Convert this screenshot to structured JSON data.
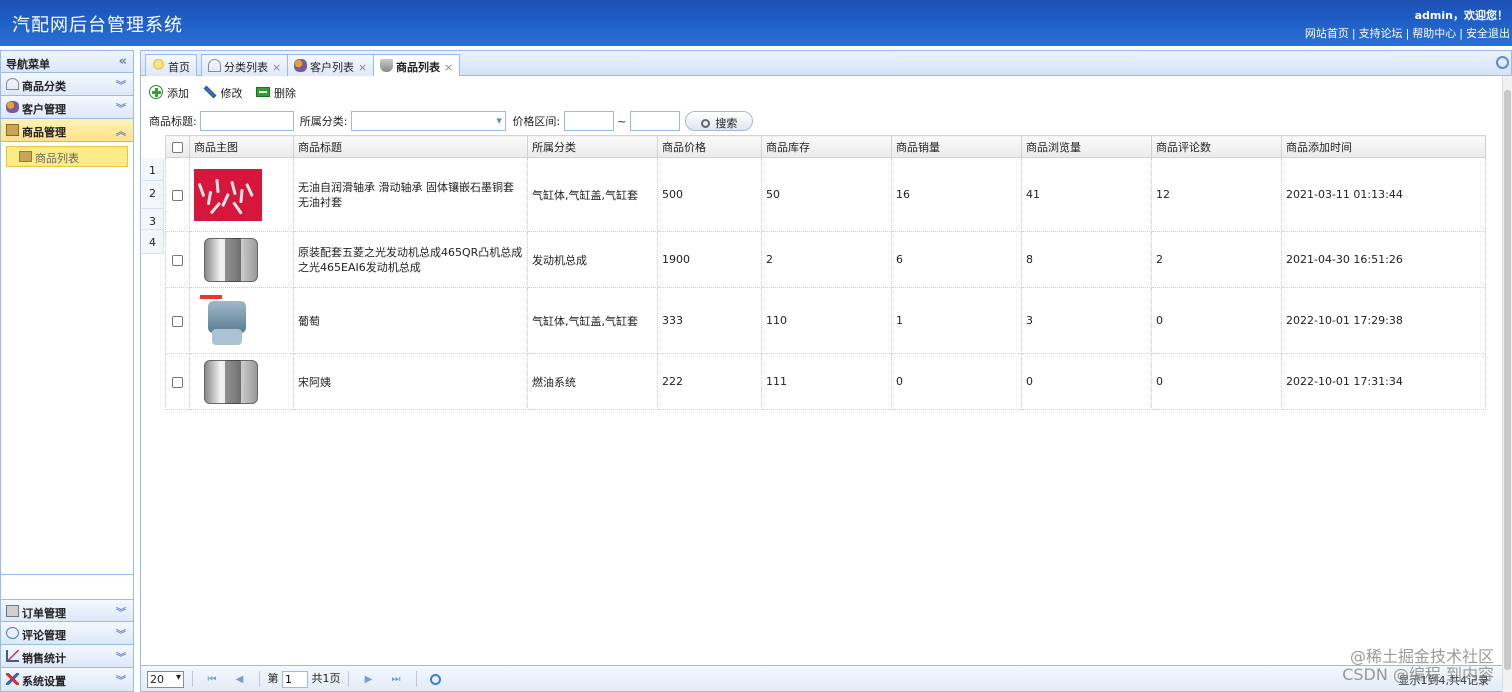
{
  "header": {
    "title": "汽配网后台管理系统",
    "welcome": "admin，欢迎您！",
    "links": [
      "网站首页",
      "支持论坛",
      "帮助中心",
      "安全退出"
    ]
  },
  "nav": {
    "title": "导航菜单",
    "sections_top": [
      {
        "label": "商品分类",
        "icon": "category-icon"
      },
      {
        "label": "客户管理",
        "icon": "users-icon"
      },
      {
        "label": "商品管理",
        "icon": "goods-icon",
        "active": true
      }
    ],
    "active_sub": "商品列表",
    "sections_bottom": [
      {
        "label": "订单管理",
        "icon": "order-icon"
      },
      {
        "label": "评论管理",
        "icon": "comment-icon"
      },
      {
        "label": "销售统计",
        "icon": "chart-icon"
      },
      {
        "label": "系统设置",
        "icon": "settings-icon"
      }
    ]
  },
  "tabs": [
    {
      "label": "首页",
      "icon": "bulb-icon",
      "closable": false
    },
    {
      "label": "分类列表",
      "icon": "category-icon",
      "closable": true
    },
    {
      "label": "客户列表",
      "icon": "users-icon",
      "closable": true
    },
    {
      "label": "商品列表",
      "icon": "cart-icon",
      "closable": true,
      "active": true
    }
  ],
  "toolbar": {
    "add": "添加",
    "edit": "修改",
    "delete": "删除"
  },
  "search": {
    "title_label": "商品标题:",
    "category_label": "所属分类:",
    "price_label": "价格区间:",
    "range_sep": "~",
    "button": "搜索"
  },
  "table": {
    "headers": [
      "商品主图",
      "商品标题",
      "所属分类",
      "商品价格",
      "商品库存",
      "商品销量",
      "商品浏览量",
      "商品评论数",
      "商品添加时间"
    ],
    "rows": [
      {
        "img": "pins",
        "title": "无油自润滑轴承 滑动轴承 固体镶嵌石墨铜套 无油衬套",
        "category": "气缸体,气缸盖,气缸套",
        "price": "500",
        "stock": "50",
        "sales": "16",
        "views": "41",
        "comments": "12",
        "time": "2021-03-11 01:13:44"
      },
      {
        "img": "filter",
        "title": "原装配套五菱之光发动机总成465QR凸机总成之光465EAI6发动机总成",
        "category": "发动机总成",
        "price": "1900",
        "stock": "2",
        "sales": "6",
        "views": "8",
        "comments": "2",
        "time": "2021-04-30 16:51:26"
      },
      {
        "img": "sensor",
        "title": "葡萄",
        "category": "气缸体,气缸盖,气缸套",
        "price": "333",
        "stock": "110",
        "sales": "1",
        "views": "3",
        "comments": "0",
        "time": "2022-10-01 17:29:38"
      },
      {
        "img": "filter",
        "title": "宋阿姨",
        "category": "燃油系统",
        "price": "222",
        "stock": "111",
        "sales": "0",
        "views": "0",
        "comments": "0",
        "time": "2022-10-01 17:31:34"
      }
    ],
    "row_numbers": [
      "1",
      "2",
      "3",
      "4"
    ]
  },
  "pager": {
    "page_size": "20",
    "page_prefix": "第",
    "page_value": "1",
    "page_suffix": "共1页",
    "info": "显示1到4,共4记录"
  },
  "watermark": {
    "line1": "@稀土掘金技术社区",
    "line2": "CSDN @编程 到内容"
  }
}
